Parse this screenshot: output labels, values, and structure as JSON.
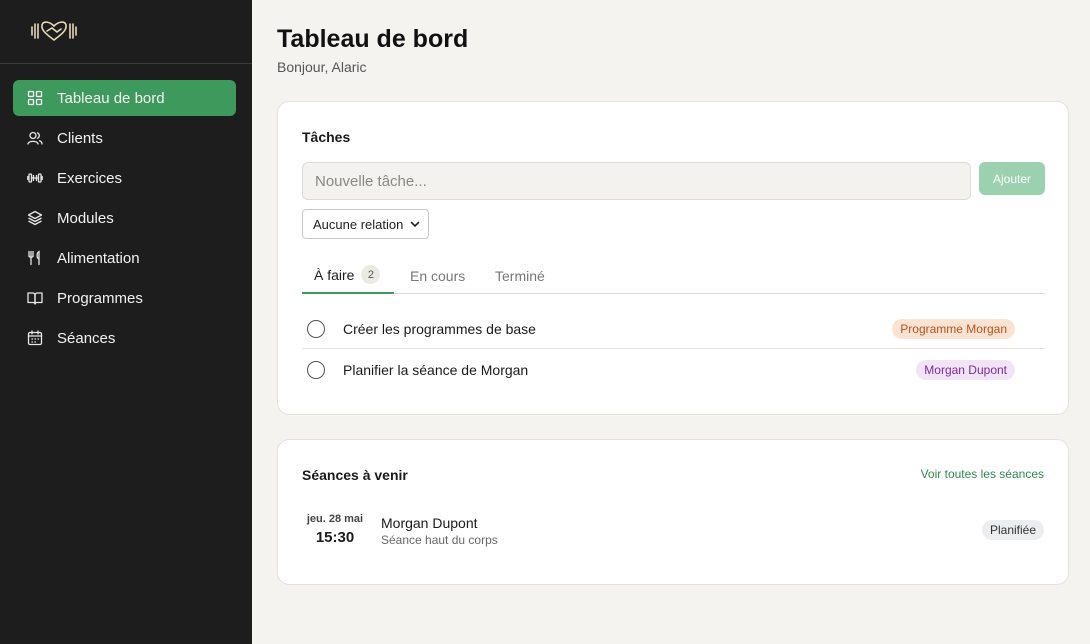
{
  "sidebar": {
    "items": [
      {
        "label": "Tableau de bord",
        "icon": "dashboard-grid-icon"
      },
      {
        "label": "Clients",
        "icon": "users-icon"
      },
      {
        "label": "Exercices",
        "icon": "dumbbell-icon"
      },
      {
        "label": "Modules",
        "icon": "layers-icon"
      },
      {
        "label": "Alimentation",
        "icon": "utensils-icon"
      },
      {
        "label": "Programmes",
        "icon": "book-open-icon"
      },
      {
        "label": "Séances",
        "icon": "calendar-icon"
      }
    ]
  },
  "header": {
    "title": "Tableau de bord",
    "subtitle": "Bonjour, Alaric"
  },
  "tasks": {
    "title": "Tâches",
    "input_placeholder": "Nouvelle tâche...",
    "add_label": "Ajouter",
    "relation_selected": "Aucune relation",
    "tabs": [
      {
        "label": "À faire",
        "count": "2"
      },
      {
        "label": "En cours"
      },
      {
        "label": "Terminé"
      }
    ],
    "items": [
      {
        "label": "Créer les programmes de base",
        "badge": "Programme Morgan"
      },
      {
        "label": "Planifier la séance de Morgan",
        "badge": "Morgan Dupont"
      }
    ]
  },
  "sessions": {
    "title": "Séances à venir",
    "view_all": "Voir toutes les séances",
    "items": [
      {
        "day": "jeu. 28 mai",
        "time": "15:30",
        "client": "Morgan Dupont",
        "description": "Séance haut du corps",
        "status": "Planifiée"
      }
    ]
  },
  "colors": {
    "accent": "#3e9a5c",
    "sidebar_bg": "#1c1d1c",
    "page_bg": "#f4f3f0"
  }
}
